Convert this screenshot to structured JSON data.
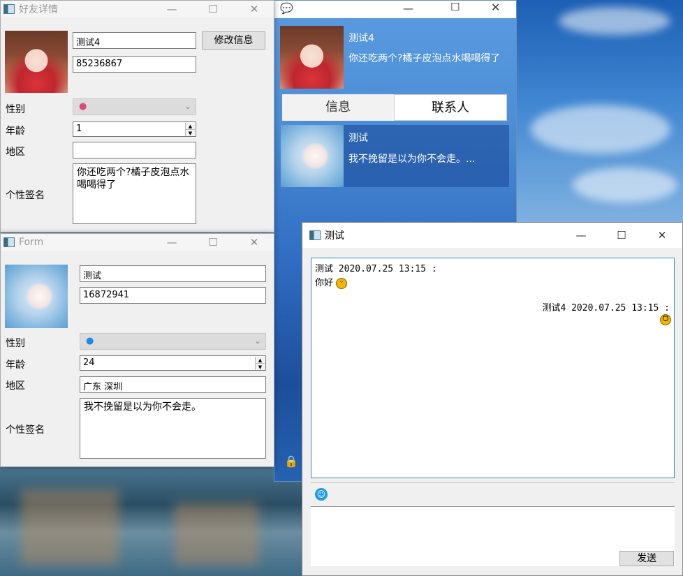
{
  "friend_detail": {
    "title": "好友详情",
    "name": "测试4",
    "id": "85236867",
    "edit_button": "修改信息",
    "gender_label": "性别",
    "age_label": "年龄",
    "age": "1",
    "region_label": "地区",
    "region": "",
    "signature_label": "个性签名",
    "signature": "你还吃两个?橘子皮泡点水喝喝得了"
  },
  "form_window": {
    "title": "Form",
    "name": "测试",
    "id": "16872941",
    "gender_label": "性别",
    "age_label": "年龄",
    "age": "24",
    "region_label": "地区",
    "region": "广东 深圳",
    "signature_label": "个性签名",
    "signature": "我不挽留是以为你不会走。"
  },
  "chat_list": {
    "profile_name": "测试4",
    "profile_signature": "你还吃两个?橘子皮泡点水喝喝得了",
    "tabs": [
      "信息",
      "联系人"
    ],
    "contacts": [
      {
        "name": "测试",
        "preview": "我不挽留是以为你不会走。..."
      }
    ]
  },
  "conversation": {
    "title": "测试",
    "messages": [
      {
        "header": "测试 2020.07.25 13:15 :",
        "text": "你好",
        "align": "left"
      },
      {
        "header": "测试4 2020.07.25 13:15 :",
        "text": "",
        "align": "right"
      }
    ],
    "send_button": "发送"
  }
}
